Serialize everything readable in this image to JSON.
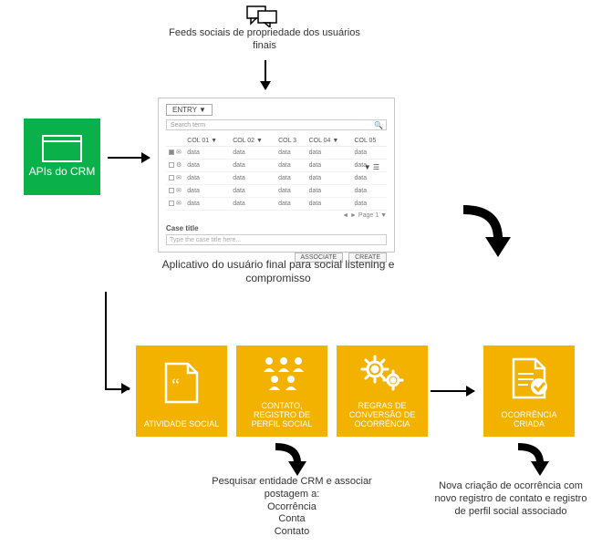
{
  "top_feeds_label": "Feeds sociais de propriedade dos usuários finais",
  "api_box_label": "APIs do CRM",
  "app": {
    "entry_label": "ENTRY ▼",
    "search_placeholder": "Search term",
    "columns": [
      "COL 01 ▼",
      "COL 02 ▼",
      "COL 3",
      "COL 04 ▼",
      "COL 05"
    ],
    "cells": [
      "data",
      "data",
      "data",
      "data",
      "data"
    ],
    "pager": "◄ ► Page 1 ▼",
    "case_title_label": "Case title",
    "case_placeholder": "Type the case title here...",
    "associate_btn": "ASSOCIATE",
    "create_btn": "CREATE"
  },
  "app_caption": "Aplicativo do usuário final para social listening e compromisso",
  "yboxes": {
    "b1": "ATIVIDADE SOCIAL",
    "b2": "CONTATO, REGISTRO DE PERFIL SOCIAL",
    "b3": "REGRAS DE CONVERSÃO DE OCORRÊNCIA",
    "b4": "OCORRÊNCIA CRIADA"
  },
  "footnote1_lines": [
    "Pesquisar entidade CRM e associar postagem a:",
    "Ocorrência",
    "Conta",
    "Contato"
  ],
  "footnote2": "Nova criação de ocorrência com novo registro de contato e registro de perfil social associado"
}
